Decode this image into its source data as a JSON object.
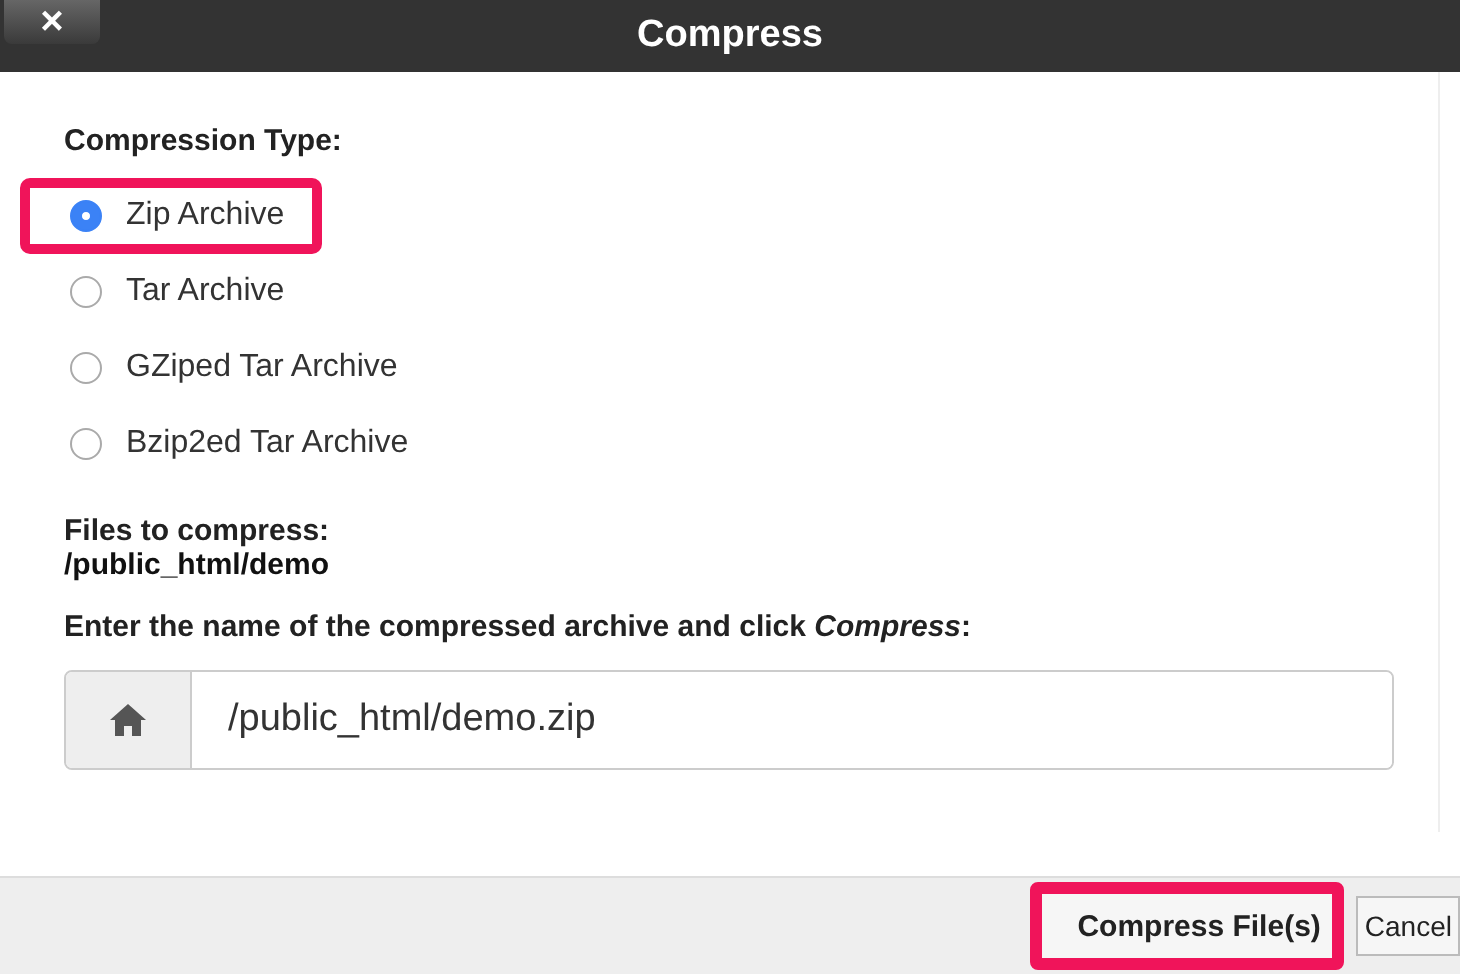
{
  "window": {
    "title": "Compress",
    "close": "×"
  },
  "compression_type": {
    "label": "Compression Type:",
    "options": [
      {
        "label": "Zip Archive",
        "selected": true,
        "highlighted": true
      },
      {
        "label": "Tar Archive",
        "selected": false,
        "highlighted": false
      },
      {
        "label": "GZiped Tar Archive",
        "selected": false,
        "highlighted": false
      },
      {
        "label": "Bzip2ed Tar Archive",
        "selected": false,
        "highlighted": false
      }
    ]
  },
  "files": {
    "label": "Files to compress:",
    "path": "/public_html/demo"
  },
  "archive_name": {
    "label": "Enter the name of the compressed archive and click *Compress*:",
    "value": "/public_html/demo.zip"
  },
  "buttons": [
    {
      "label": "Compress File(s)",
      "kind": "primary",
      "highlighted": true
    },
    {
      "label": "Cancel",
      "kind": "secondary",
      "highlighted": false
    }
  ]
}
